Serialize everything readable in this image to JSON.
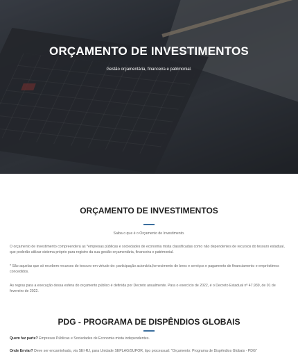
{
  "hero": {
    "title": "ORÇAMENTO DE INVESTIMENTOS",
    "subtitle": "Gestão orçamentária, financeira e patrimonial."
  },
  "section1": {
    "title": "ORÇAMENTO DE INVESTIMENTOS",
    "intro": "Saiba o que é o Orçamento de Investimento.",
    "p1": "O orçamento de investimento compreenderá as *empresas públicas e sociedades de economia mista classificadas como não dependentes de recursos do tesouro estadual, que poderão utilizar sistema próprio para registro da sua gestão orçamentária, financeira e patrimonial.",
    "p2": "* São aquelas que só recebem recursos do tesouro em virtude de: participação acionária,fornecimento de bens e serviços e pagamento de financiamento e empréstimos concedidos.",
    "p3": "As regras para a execução dessa esfera do orçamento público é definida por Decreto anualmente. Para o exercício de 2022, é o Decreto Estadual nº 47.939, de 01 de fevereiro de 2022."
  },
  "section2": {
    "title": "PDG - PROGRAMA DE DISPÊNDIOS GLOBAIS",
    "q1_label": "Quem faz parte?",
    "q1_text": " Empresas Públicas e Sociedades de Economia mista independentes.",
    "q2_label": "Onde Enviar?",
    "q2_text": " Deve ser encaminhado, via SEI-RJ, para Unidade SEPLAG/SUPOR, tipo processual: \"Orçamento: Programa de Dispêndios Globais - PDG\""
  },
  "colors": {
    "accent": "#3a6e9e",
    "heading": "#222222",
    "body_text": "#666666"
  }
}
